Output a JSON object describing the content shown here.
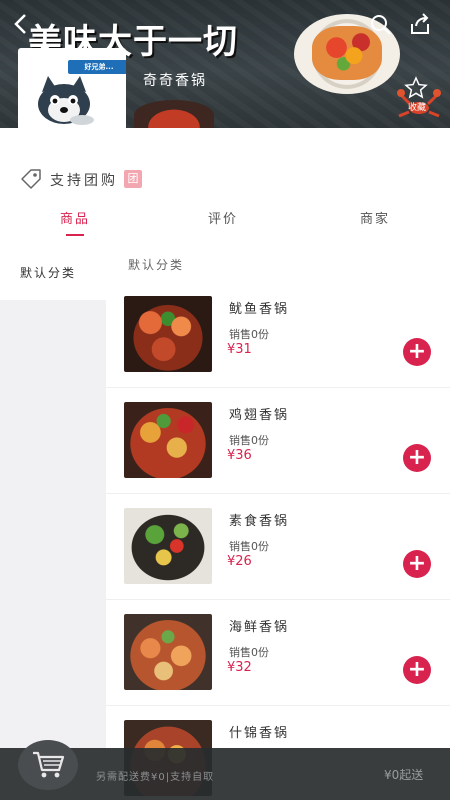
{
  "header": {
    "banner_title": "美味大于一切",
    "favorite_label": "收藏"
  },
  "shop": {
    "name": "奇奇香锅",
    "logo_text": "好兄弟..."
  },
  "group_buy": {
    "label": "支持团购",
    "badge": "团"
  },
  "tabs": [
    {
      "label": "商品",
      "active": true
    },
    {
      "label": "评价",
      "active": false
    },
    {
      "label": "商家",
      "active": false
    }
  ],
  "sidebar": {
    "items": [
      {
        "label": "默认分类",
        "active": true
      }
    ]
  },
  "category_header": "默认分类",
  "products": [
    {
      "name": "鱿鱼香锅",
      "sales": "销售0份",
      "price": "¥31"
    },
    {
      "name": "鸡翅香锅",
      "sales": "销售0份",
      "price": "¥36"
    },
    {
      "name": "素食香锅",
      "sales": "销售0份",
      "price": "¥26"
    },
    {
      "name": "海鲜香锅",
      "sales": "销售0份",
      "price": "¥32"
    },
    {
      "name": "什锦香锅",
      "sales": "",
      "price": ""
    }
  ],
  "cart": {
    "note": "另需配送费¥0|支持自取",
    "minimum": "¥0起送"
  },
  "colors": {
    "accent": "#d9234f",
    "banner_bg": "#333b3e",
    "cart_bar": "#2c3032"
  }
}
